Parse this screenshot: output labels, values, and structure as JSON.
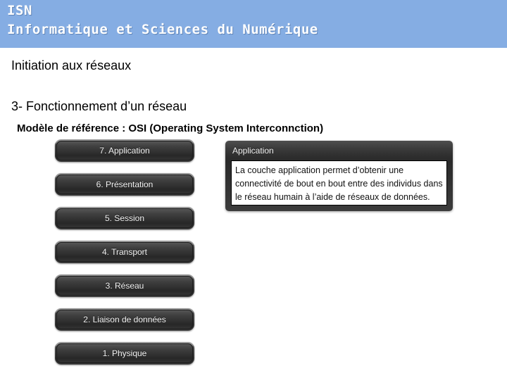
{
  "header": {
    "line1": "ISN",
    "line2": "Informatique et Sciences du Numérique",
    "background_color": "#85ade3",
    "text_color": "#ffffff"
  },
  "slide": {
    "subtitle": "Initiation aux réseaux",
    "section_heading": "3- Fonctionnement d’un réseau",
    "model_heading": "Modèle de référence : OSI (Operating System  Interconnction)"
  },
  "osi_layers": [
    {
      "label": "7. Application"
    },
    {
      "label": "6. Présentation"
    },
    {
      "label": "5. Session"
    },
    {
      "label": "4. Transport"
    },
    {
      "label": "3. Réseau"
    },
    {
      "label": "2. Liaison de données"
    },
    {
      "label": "1. Physique"
    }
  ],
  "description_panel": {
    "title": "Application",
    "lines": [
      "La couche application permet d’obtenir une",
      "connectivité de bout en bout entre des individus dans",
      "le réseau humain à l’aide de réseaux de données."
    ]
  }
}
